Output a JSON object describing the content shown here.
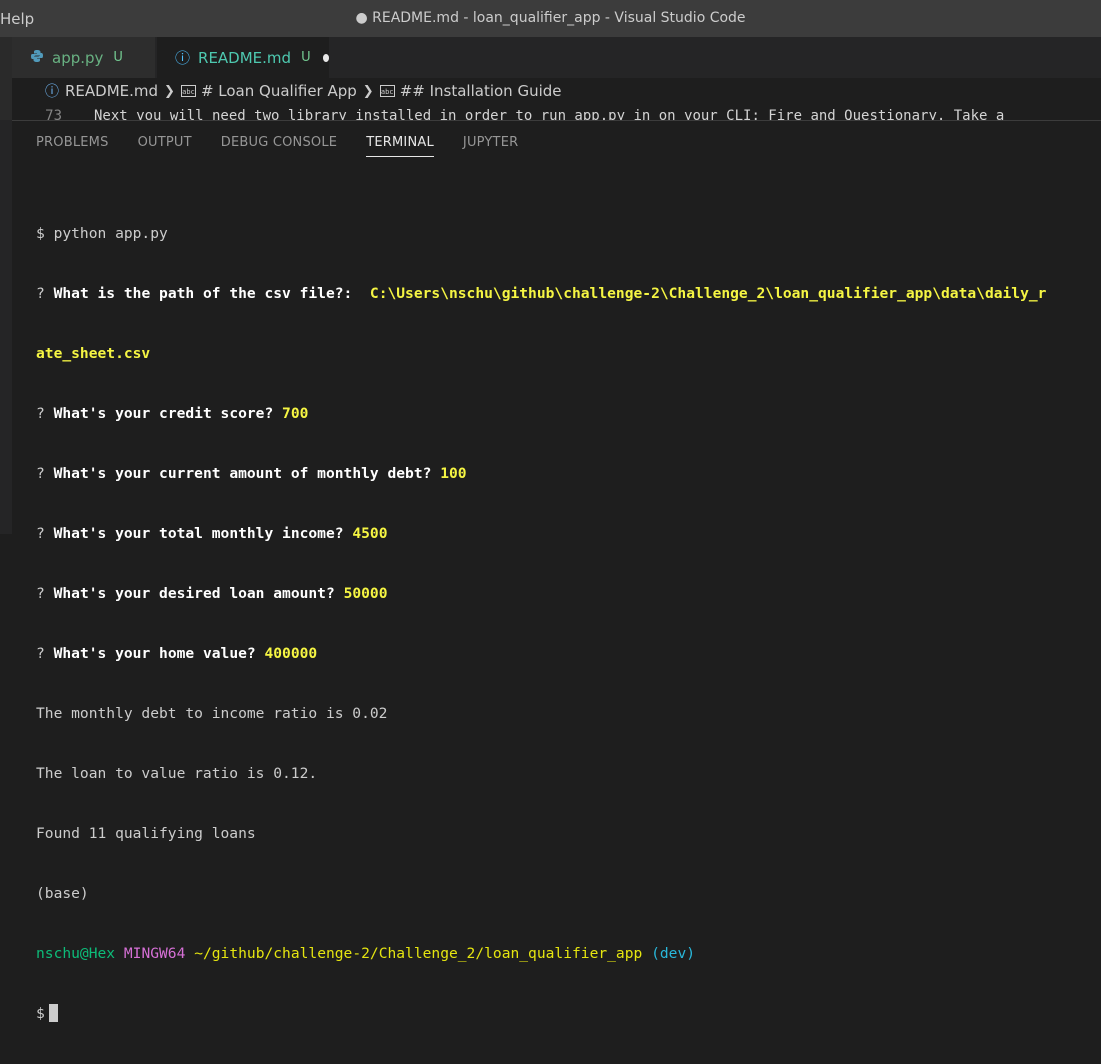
{
  "titlebar": {
    "menu_help": "Help",
    "window_title": "● README.md - loan_qualifier_app - Visual Studio Code"
  },
  "tabs": [
    {
      "label": "app.py",
      "status": "U",
      "icon": "python-icon"
    },
    {
      "label": "README.md",
      "status": "U",
      "icon": "info-icon",
      "dirty": true
    }
  ],
  "breadcrumb": {
    "file": "README.md",
    "heading1": "# Loan Qualifier App",
    "heading2": "## Installation Guide"
  },
  "editor": {
    "line_number": "73",
    "line_text": "Next you will need two library installed in order to run app.py in on your CLI: Fire and Questionary. Take a"
  },
  "panel": {
    "tabs": [
      "PROBLEMS",
      "OUTPUT",
      "DEBUG CONSOLE",
      "TERMINAL",
      "JUPYTER"
    ],
    "active_tab": "TERMINAL"
  },
  "terminal": {
    "command": "$ python app.py",
    "questions": [
      {
        "mark": "?",
        "text": "What is the path of the csv file?:",
        "answer": "C:\\Users\\nschu\\github\\challenge-2\\Challenge_2\\loan_qualifier_app\\data\\daily_r",
        "answer_cont": "ate_sheet.csv"
      },
      {
        "mark": "?",
        "text": "What's your credit score?",
        "answer": "700"
      },
      {
        "mark": "?",
        "text": "What's your current amount of monthly debt?",
        "answer": "100"
      },
      {
        "mark": "?",
        "text": "What's your total monthly income?",
        "answer": "4500"
      },
      {
        "mark": "?",
        "text": "What's your desired loan amount?",
        "answer": "50000"
      },
      {
        "mark": "?",
        "text": "What's your home value?",
        "answer": "400000"
      }
    ],
    "output": [
      "The monthly debt to income ratio is 0.02",
      "The loan to value ratio is 0.12.",
      "Found 11 qualifying loans",
      "(base)"
    ],
    "prompt": {
      "user": "nschu@Hex",
      "system": "MINGW64",
      "path": "~/github/challenge-2/Challenge_2/loan_qualifier_app",
      "branch": "(dev)",
      "symbol": "$"
    }
  },
  "colors": {
    "answer": "#f5f543",
    "user": "#23d18b",
    "system": "#d670d6",
    "path": "#e5e510",
    "branch": "#29b8db"
  }
}
